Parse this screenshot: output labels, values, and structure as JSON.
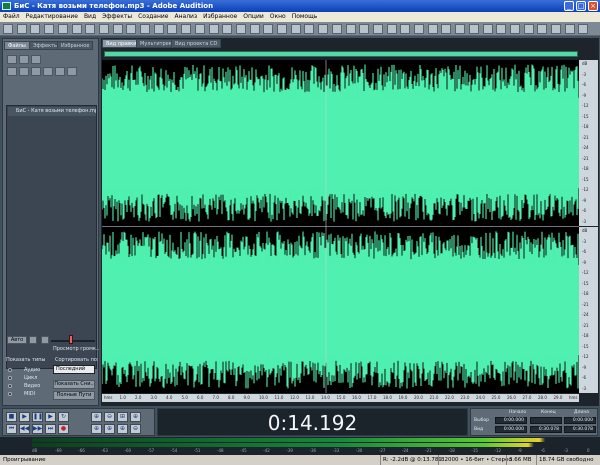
{
  "window": {
    "title": "БиС - Катя возьми телефон.mp3 - Adobe Audition",
    "buttons": {
      "minimize": "_",
      "maximize": "□",
      "close": "×"
    }
  },
  "menu": [
    "Файл",
    "Редактирование",
    "Вид",
    "Эффекты",
    "Создание",
    "Анализ",
    "Избранное",
    "Опции",
    "Окно",
    "Помощь"
  ],
  "left_panel": {
    "tabs": [
      "Файлы",
      "Эффекты",
      "Избранное"
    ],
    "file_name": "БиС - Катя возьми телефон.mp3",
    "auto_label": "Авто",
    "preview_label": "Просмотр громк..",
    "show_types_label": "Показать типы",
    "sort_label": "Сортировать по:",
    "sort_value": "Последний",
    "types": [
      "Аудио",
      "Цикл",
      "Видео",
      "MIDI"
    ],
    "show_full_button": "Показать Сни..",
    "full_paths_button": "Полные Пути"
  },
  "view_tabs": [
    "Вид правки",
    "Мультитрек",
    "Вид проекта CD"
  ],
  "amplitude_ticks": [
    "dB",
    "-3",
    "-6",
    "-9",
    "-12",
    "-15",
    "-18",
    "-21",
    "-24",
    "-21",
    "-18",
    "-15",
    "-12",
    "-9",
    "-6",
    "-3"
  ],
  "time_ruler": [
    "hms",
    "1.0",
    "2.0",
    "3.0",
    "4.0",
    "5.0",
    "6.0",
    "7.0",
    "8.0",
    "9.0",
    "10.0",
    "11.0",
    "12.0",
    "13.0",
    "14.0",
    "15.0",
    "16.0",
    "17.0",
    "18.0",
    "19.0",
    "20.0",
    "21.0",
    "22.0",
    "23.0",
    "24.0",
    "25.0",
    "26.0",
    "27.0",
    "28.0",
    "29.0",
    "hms"
  ],
  "time_display": "0:14.192",
  "selection": {
    "headers": [
      "Начало",
      "Конец",
      "Длина"
    ],
    "rows": [
      {
        "label": "Выбор",
        "begin": "0:00.000",
        "end": "",
        "length": "0:00.000"
      },
      {
        "label": "Вид",
        "begin": "0:00.000",
        "end": "0:30.078",
        "length": "0:30.078"
      }
    ]
  },
  "meter_scale": [
    "dB",
    "-69",
    "-66",
    "-63",
    "-60",
    "-57",
    "-54",
    "-51",
    "-48",
    "-45",
    "-42",
    "-39",
    "-36",
    "-33",
    "-30",
    "-27",
    "-24",
    "-21",
    "-18",
    "-15",
    "-12",
    "-9",
    "-6",
    "-3",
    "0"
  ],
  "status": {
    "state": "Проигрывание",
    "level": "R: -2.2dB @ 0:13.789",
    "format": "32000 • 16-бит • Стерео",
    "size": "3.66 MB",
    "free": "18.74 GB свободно"
  },
  "colors": {
    "waveform": "#4ff0b0",
    "background": "#000000",
    "meter_peak": "#e4d22a"
  }
}
